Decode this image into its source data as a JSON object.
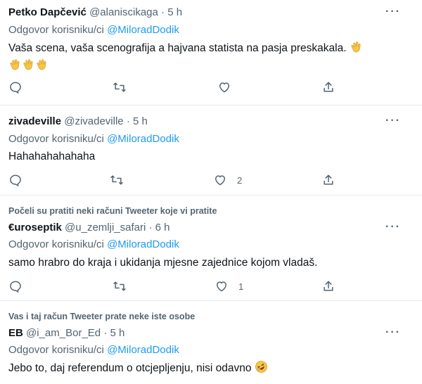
{
  "tweets": [
    {
      "name": "Petko Dapčević",
      "handle": "@alaniscikaga",
      "dot": "·",
      "time": "5 h",
      "reply_prefix": "Odgovor korisniku/ci",
      "reply_mention": "@MiloradDodik",
      "text": "Vaša scena, vaša scenografija a hajvana statista na pasja preskakala.",
      "emoji": "clapping-hands x4",
      "likes": ""
    },
    {
      "name": "zivadeville",
      "handle": "@zivadeville",
      "dot": "·",
      "time": "5 h",
      "reply_prefix": "Odgovor korisniku/ci",
      "reply_mention": "@MiloradDodik",
      "text": "Hahahahahahaha",
      "likes": "2"
    },
    {
      "context": "Počeli su pratiti neki računi Tweeter koje vi pratite",
      "name": "€uroseptik",
      "handle": "@u_zemlji_safari",
      "dot": "·",
      "time": "6 h",
      "reply_prefix": "Odgovor korisniku/ci",
      "reply_mention": "@MiloradDodik",
      "text": "samo hrabro do kraja i ukidanja mjesne zajednice kojom vladaš.",
      "likes": "1"
    },
    {
      "context": "Vas i taj račun Tweeter prate neke iste osobe",
      "name": "EB",
      "handle": "@i_am_Bor_Ed",
      "dot": "·",
      "time": "5 h",
      "reply_prefix": "Odgovor korisniku/ci",
      "reply_mention": "@MiloradDodik",
      "text": "Jebo to, daj referendum o otcjepljenju, nisi odavno",
      "emoji": "rolling-on-floor-laughing"
    }
  ],
  "more_label": "···",
  "colors": {
    "link": "#1d9bf0",
    "muted": "#536471",
    "text": "#0f1419",
    "divider": "#e6ecf0"
  }
}
